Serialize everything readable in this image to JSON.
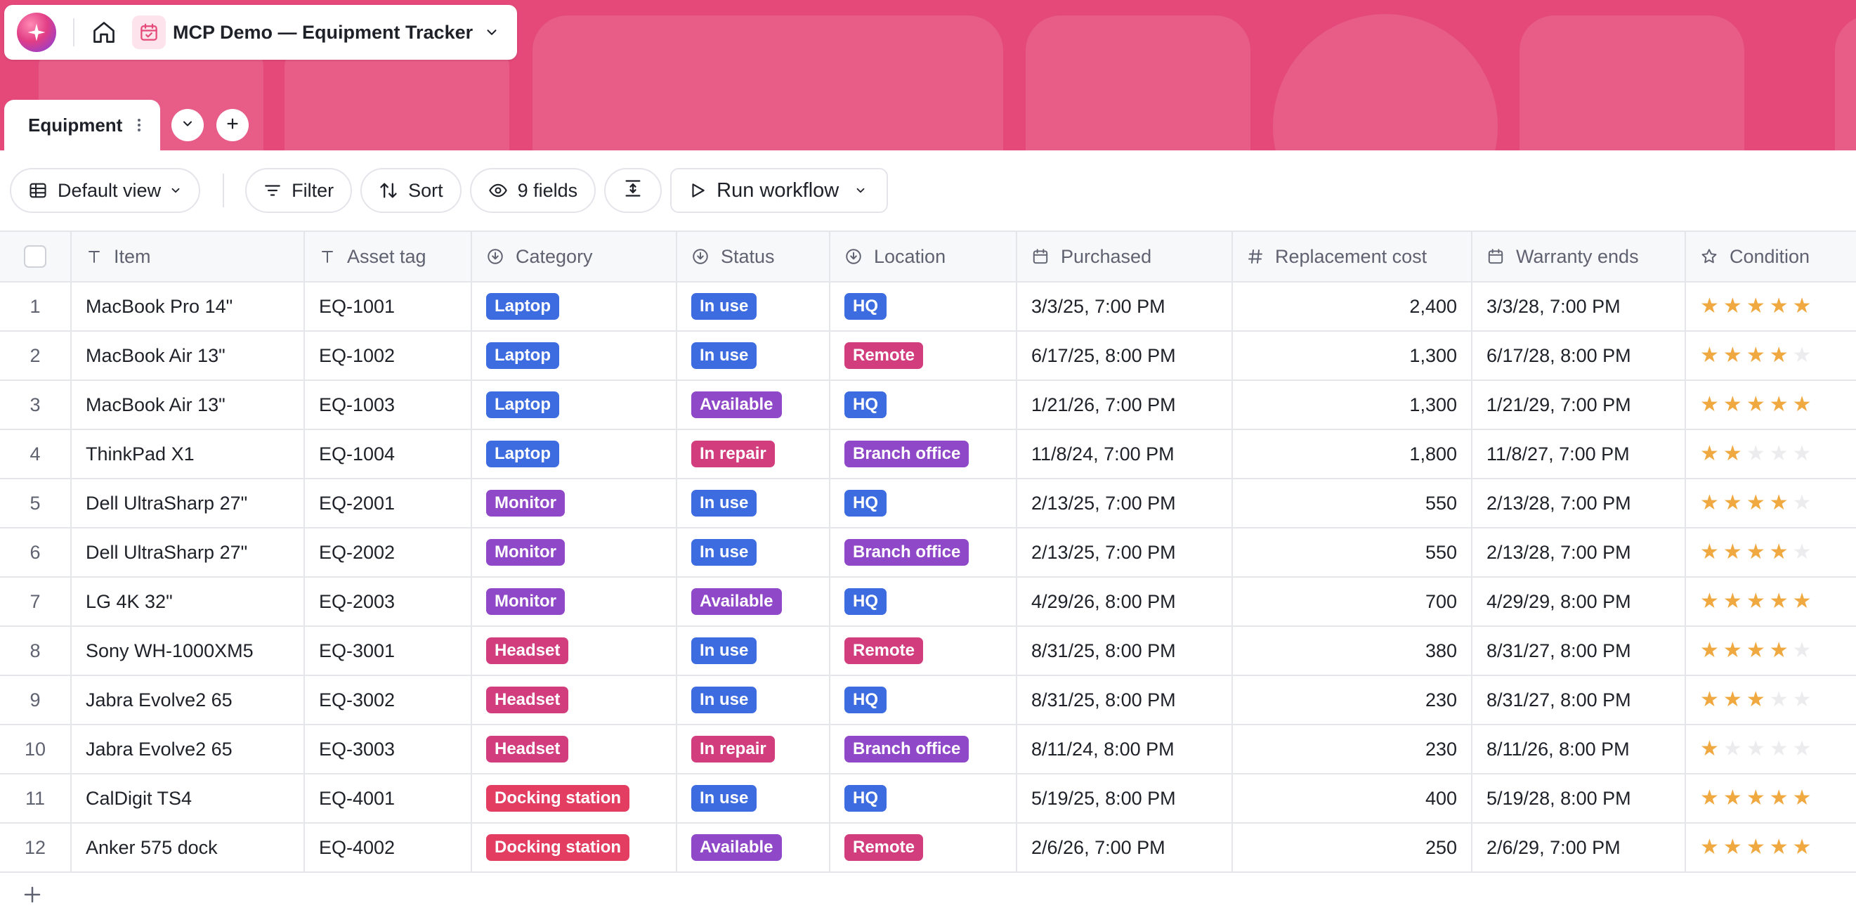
{
  "app": {
    "logo_icon": "sparkle-logo-icon",
    "home_icon": "home-icon",
    "base_icon": "calendar-check-icon",
    "base_title": "MCP Demo — Equipment Tracker",
    "banner_color": "#e4497a"
  },
  "tabs": [
    {
      "label": "Equipment",
      "active": true
    }
  ],
  "toolbar": {
    "view_label": "Default view",
    "filter_label": "Filter",
    "sort_label": "Sort",
    "fields_label": "9 fields",
    "run_workflow_label": "Run workflow"
  },
  "columns": [
    {
      "label": "Item",
      "icon": "text-icon"
    },
    {
      "label": "Asset tag",
      "icon": "text-icon"
    },
    {
      "label": "Category",
      "icon": "select-icon"
    },
    {
      "label": "Status",
      "icon": "select-icon"
    },
    {
      "label": "Location",
      "icon": "select-icon"
    },
    {
      "label": "Purchased",
      "icon": "calendar-icon"
    },
    {
      "label": "Replacement cost",
      "icon": "hash-icon"
    },
    {
      "label": "Warranty ends",
      "icon": "calendar-icon"
    },
    {
      "label": "Condition",
      "icon": "star-outline-icon"
    }
  ],
  "pill_colors": {
    "Laptop": "#3d6ce0",
    "Monitor": "#8e48c8",
    "Headset": "#d23d7e",
    "Docking station": "#e33e62",
    "In use": "#3d6ce0",
    "Available": "#8e48c8",
    "In repair": "#d23d7e",
    "HQ": "#3d6ce0",
    "Remote": "#d23d7e",
    "Branch office": "#8e48c8"
  },
  "rows": [
    {
      "num": "1",
      "item": "MacBook Pro 14\"",
      "tag": "EQ-1001",
      "category": "Laptop",
      "status": "In use",
      "location": "HQ",
      "purchased": "3/3/25, 7:00 PM",
      "cost": "2,400",
      "warranty": "3/3/28, 7:00 PM",
      "condition": 5
    },
    {
      "num": "2",
      "item": "MacBook Air 13\"",
      "tag": "EQ-1002",
      "category": "Laptop",
      "status": "In use",
      "location": "Remote",
      "purchased": "6/17/25, 8:00 PM",
      "cost": "1,300",
      "warranty": "6/17/28, 8:00 PM",
      "condition": 4
    },
    {
      "num": "3",
      "item": "MacBook Air 13\"",
      "tag": "EQ-1003",
      "category": "Laptop",
      "status": "Available",
      "location": "HQ",
      "purchased": "1/21/26, 7:00 PM",
      "cost": "1,300",
      "warranty": "1/21/29, 7:00 PM",
      "condition": 5
    },
    {
      "num": "4",
      "item": "ThinkPad X1",
      "tag": "EQ-1004",
      "category": "Laptop",
      "status": "In repair",
      "location": "Branch office",
      "purchased": "11/8/24, 7:00 PM",
      "cost": "1,800",
      "warranty": "11/8/27, 7:00 PM",
      "condition": 2
    },
    {
      "num": "5",
      "item": "Dell UltraSharp 27\"",
      "tag": "EQ-2001",
      "category": "Monitor",
      "status": "In use",
      "location": "HQ",
      "purchased": "2/13/25, 7:00 PM",
      "cost": "550",
      "warranty": "2/13/28, 7:00 PM",
      "condition": 4
    },
    {
      "num": "6",
      "item": "Dell UltraSharp 27\"",
      "tag": "EQ-2002",
      "category": "Monitor",
      "status": "In use",
      "location": "Branch office",
      "purchased": "2/13/25, 7:00 PM",
      "cost": "550",
      "warranty": "2/13/28, 7:00 PM",
      "condition": 4
    },
    {
      "num": "7",
      "item": "LG 4K 32\"",
      "tag": "EQ-2003",
      "category": "Monitor",
      "status": "Available",
      "location": "HQ",
      "purchased": "4/29/26, 8:00 PM",
      "cost": "700",
      "warranty": "4/29/29, 8:00 PM",
      "condition": 5
    },
    {
      "num": "8",
      "item": "Sony WH-1000XM5",
      "tag": "EQ-3001",
      "category": "Headset",
      "status": "In use",
      "location": "Remote",
      "purchased": "8/31/25, 8:00 PM",
      "cost": "380",
      "warranty": "8/31/27, 8:00 PM",
      "condition": 4
    },
    {
      "num": "9",
      "item": "Jabra Evolve2 65",
      "tag": "EQ-3002",
      "category": "Headset",
      "status": "In use",
      "location": "HQ",
      "purchased": "8/31/25, 8:00 PM",
      "cost": "230",
      "warranty": "8/31/27, 8:00 PM",
      "condition": 3
    },
    {
      "num": "10",
      "item": "Jabra Evolve2 65",
      "tag": "EQ-3003",
      "category": "Headset",
      "status": "In repair",
      "location": "Branch office",
      "purchased": "8/11/24, 8:00 PM",
      "cost": "230",
      "warranty": "8/11/26, 8:00 PM",
      "condition": 1
    },
    {
      "num": "11",
      "item": "CalDigit TS4",
      "tag": "EQ-4001",
      "category": "Docking station",
      "status": "In use",
      "location": "HQ",
      "purchased": "5/19/25, 8:00 PM",
      "cost": "400",
      "warranty": "5/19/28, 8:00 PM",
      "condition": 5
    },
    {
      "num": "12",
      "item": "Anker 575 dock",
      "tag": "EQ-4002",
      "category": "Docking station",
      "status": "Available",
      "location": "Remote",
      "purchased": "2/6/26, 7:00 PM",
      "cost": "250",
      "warranty": "2/6/29, 7:00 PM",
      "condition": 5
    }
  ],
  "rating_max": 5,
  "star_color": "#f0a840"
}
